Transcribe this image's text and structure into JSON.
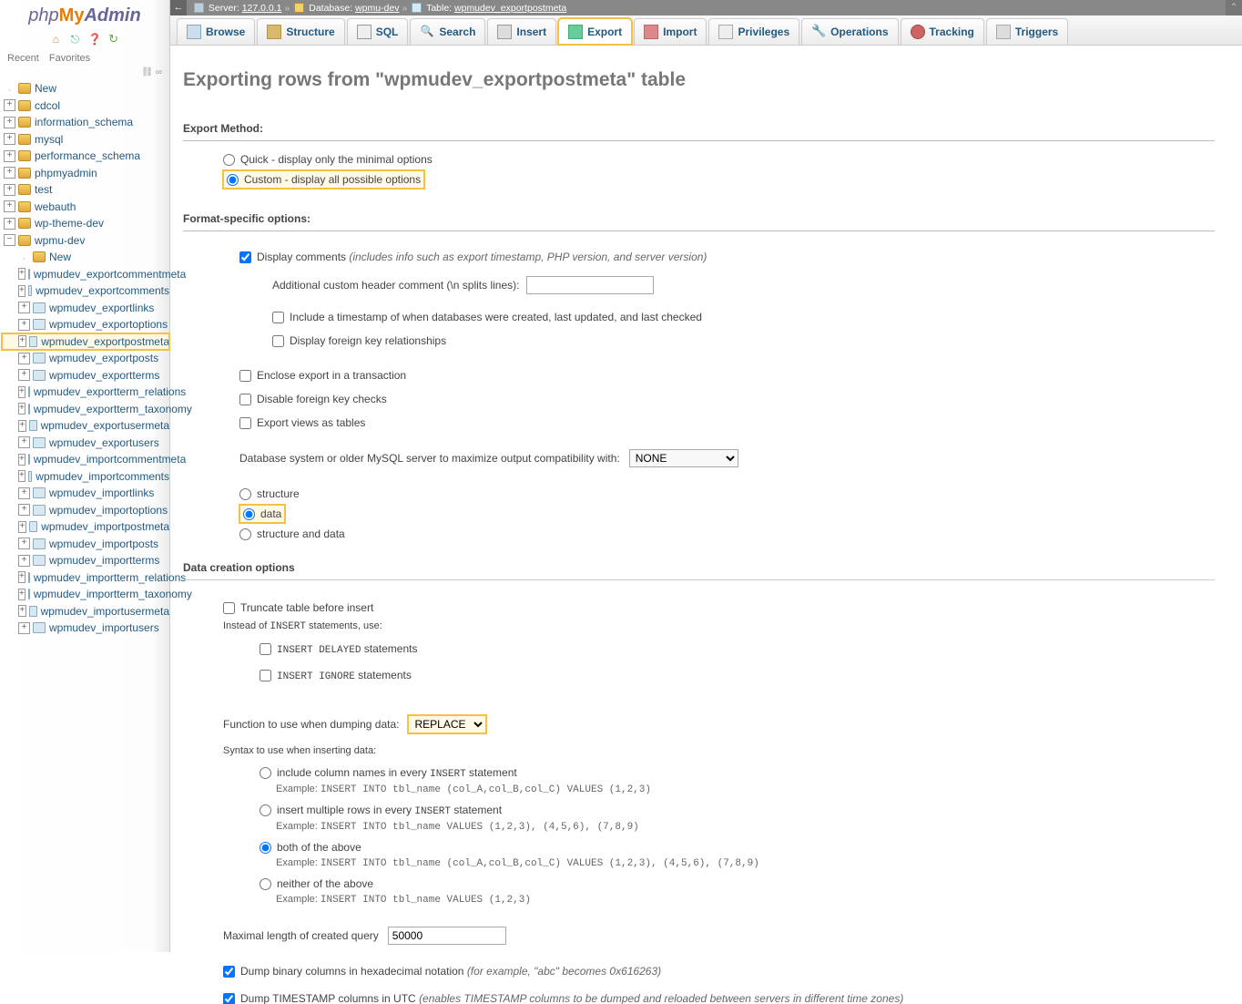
{
  "logo": {
    "php": "php",
    "my": "My",
    "admin": "Admin"
  },
  "sidebarTabs": {
    "recent": "Recent",
    "favorites": "Favorites"
  },
  "tree": {
    "new": "New",
    "dbs": [
      "cdcol",
      "information_schema",
      "mysql",
      "performance_schema",
      "phpmyadmin",
      "test",
      "webauth",
      "wp-theme-dev"
    ],
    "activeDb": "wpmu-dev",
    "new2": "New",
    "tables": [
      "wpmudev_exportcommentmeta",
      "wpmudev_exportcomments",
      "wpmudev_exportlinks",
      "wpmudev_exportoptions",
      "wpmudev_exportpostmeta",
      "wpmudev_exportposts",
      "wpmudev_exportterms",
      "wpmudev_exportterm_relations",
      "wpmudev_exportterm_taxonomy",
      "wpmudev_exportusermeta",
      "wpmudev_exportusers",
      "wpmudev_importcommentmeta",
      "wpmudev_importcomments",
      "wpmudev_importlinks",
      "wpmudev_importoptions",
      "wpmudev_importpostmeta",
      "wpmudev_importposts",
      "wpmudev_importterms",
      "wpmudev_importterm_relations",
      "wpmudev_importterm_taxonomy",
      "wpmudev_importusermeta",
      "wpmudev_importusers"
    ],
    "highlightTable": "wpmudev_exportpostmeta"
  },
  "breadcrumb": {
    "serverLabel": "Server:",
    "server": "127.0.0.1",
    "dbLabel": "Database:",
    "db": "wpmu-dev",
    "tableLabel": "Table:",
    "table": "wpmudev_exportpostmeta"
  },
  "tabs": {
    "browse": "Browse",
    "structure": "Structure",
    "sql": "SQL",
    "search": "Search",
    "insert": "Insert",
    "export": "Export",
    "import": "Import",
    "privileges": "Privileges",
    "operations": "Operations",
    "tracking": "Tracking",
    "triggers": "Triggers"
  },
  "page": {
    "title": "Exporting rows from \"wpmudev_exportpostmeta\" table",
    "exportMethod": {
      "heading": "Export Method:",
      "quick": "Quick - display only the minimal options",
      "custom": "Custom - display all possible options"
    },
    "formatSpecific": {
      "heading": "Format-specific options:",
      "displayComments": "Display comments",
      "displayCommentsHint": "(includes info such as export timestamp, PHP version, and server version)",
      "additionalHeader": "Additional custom header comment (\\n splits lines):",
      "includeTimestamp": "Include a timestamp of when databases were created, last updated, and last checked",
      "foreignKey": "Display foreign key relationships",
      "enclose": "Enclose export in a transaction",
      "disableFk": "Disable foreign key checks",
      "exportViews": "Export views as tables",
      "compatLabel": "Database system or older MySQL server to maximize output compatibility with:",
      "compatValue": "NONE",
      "structure": "structure",
      "data": "data",
      "structData": "structure and data"
    },
    "dataCreation": {
      "heading": "Data creation options",
      "truncate": "Truncate table before insert",
      "insteadOf": "Instead of",
      "insertKw": "INSERT",
      "insteadOfTail": " statements, use:",
      "delayedKw": "INSERT DELAYED",
      "delayedTail": " statements",
      "ignoreKw": "INSERT IGNORE",
      "ignoreTail": " statements",
      "funcDump": "Function to use when dumping data:",
      "funcValue": "REPLACE",
      "syntaxLabel": "Syntax to use when inserting data:",
      "s1a": "include column names in every ",
      "s1b": " statement",
      "s1ex_pre": "Example: ",
      "s1ex": "INSERT INTO tbl_name (col_A,col_B,col_C) VALUES (1,2,3)",
      "s2a": "insert multiple rows in every ",
      "s2b": " statement",
      "s2ex": "INSERT INTO tbl_name VALUES (1,2,3), (4,5,6), (7,8,9)",
      "s3": "both of the above",
      "s3ex": "INSERT INTO tbl_name (col_A,col_B,col_C) VALUES (1,2,3), (4,5,6), (7,8,9)",
      "s4": "neither of the above",
      "s4ex": "INSERT INTO tbl_name VALUES (1,2,3)",
      "maxLenLabel": "Maximal length of created query",
      "maxLenValue": "50000",
      "dumpBinary": "Dump binary columns in hexadecimal notation",
      "dumpBinaryHint": "(for example, \"abc\" becomes 0x616263)",
      "dumpTs": "Dump TIMESTAMP columns in UTC",
      "dumpTsHint": "(enables TIMESTAMP columns to be dumped and reloaded between servers in different time zones)"
    }
  }
}
